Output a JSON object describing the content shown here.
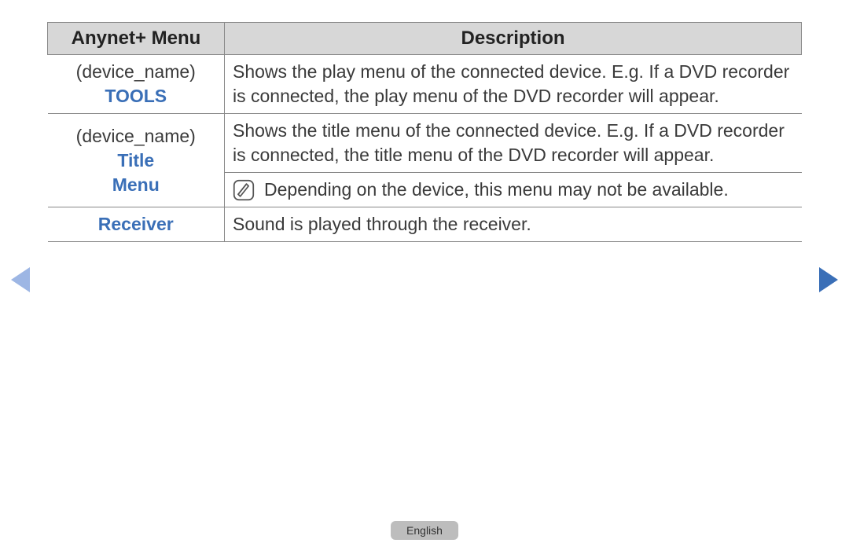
{
  "table": {
    "headers": {
      "col1": "Anynet+ Menu",
      "col2": "Description"
    },
    "rows": [
      {
        "left_plain": "(device_name)",
        "left_blue": "TOOLS",
        "desc": "Shows the play menu of the connected device. E.g. If a DVD recorder is connected, the play menu of the DVD recorder will appear."
      },
      {
        "left_plain": "(device_name) ",
        "left_blue_inline": "Title",
        "left_blue_line2": "Menu",
        "desc": "Shows the title menu of the connected device. E.g. If a DVD recorder is connected, the title menu of the DVD recorder will appear.",
        "note": "Depending on the device, this menu may not be available."
      },
      {
        "left_blue": "Receiver",
        "desc": "Sound is played through the receiver."
      }
    ]
  },
  "footer": {
    "language": "English"
  }
}
